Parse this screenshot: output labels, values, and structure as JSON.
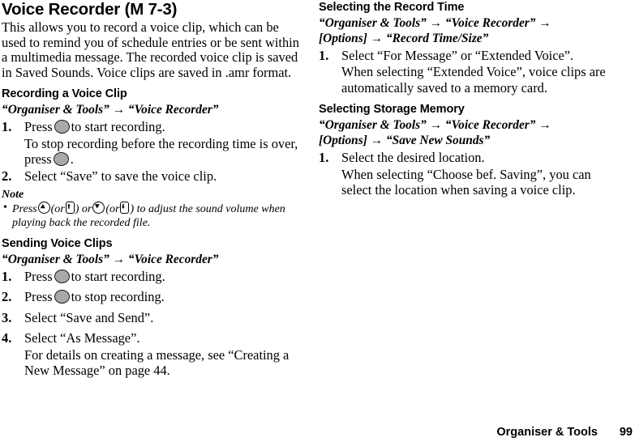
{
  "document": {
    "title": "Voice Recorder (M 7-3)",
    "intro": "This allows you to record a voice clip, which can be used to remind you of schedule entries or be sent within a multimedia message. The recorded voice clip is saved in Saved Sounds. Voice clips are saved in .amr format."
  },
  "arrow_glyph": "→",
  "bullet_glyph": "•",
  "left_column": {
    "sections": [
      {
        "heading": "Recording a Voice Clip",
        "path": "“Organiser & Tools” → “Voice Recorder”",
        "steps": [
          {
            "num": "1.",
            "text_before": "Press",
            "icon": "center-key-icon",
            "text_after": "to start recording.",
            "sub_before": "To stop recording before the recording time is over, press",
            "sub_icon": "center-key-icon",
            "sub_after": "."
          },
          {
            "num": "2.",
            "text": "Select “Save” to save the voice clip."
          }
        ],
        "note": {
          "label": "Note",
          "bullet_part_1": "Press",
          "icon_1": "nav-key-up-icon",
          "bullet_part_2": "(or",
          "icon_2": "side-key-up-icon",
          "bullet_part_3": ") or",
          "icon_3": "nav-key-down-icon",
          "bullet_part_4": "(or",
          "icon_4": "side-key-down-icon",
          "bullet_part_5": ") to adjust the sound volume when playing back the recorded file."
        }
      },
      {
        "heading": "Sending Voice Clips",
        "path": "“Organiser & Tools” → “Voice Recorder”",
        "steps": [
          {
            "num": "1.",
            "text_before": "Press",
            "icon": "center-key-icon",
            "text_after": "to start recording."
          },
          {
            "num": "2.",
            "text_before": "Press",
            "icon": "center-key-icon",
            "text_after": "to stop recording."
          },
          {
            "num": "3.",
            "text": "Select “Save and Send”."
          },
          {
            "num": "4.",
            "text": "Select “As Message”.",
            "sub": "For details on creating a message, see “Creating a New Message” on page 44."
          }
        ]
      }
    ]
  },
  "right_column": {
    "sections": [
      {
        "heading": "Selecting the Record Time",
        "path_line_1": "“Organiser & Tools” → “Voice Recorder” →",
        "path_line_2": "[Options] → “Record Time/Size”",
        "steps": [
          {
            "num": "1.",
            "text": "Select “For Message” or “Extended Voice”.",
            "sub": "When selecting “Extended Voice”, voice clips are automatically saved to a memory card."
          }
        ]
      },
      {
        "heading": "Selecting Storage Memory",
        "path_line_1": "“Organiser & Tools” → “Voice Recorder” →",
        "path_line_2": "[Options] → “Save New Sounds”",
        "steps": [
          {
            "num": "1.",
            "text": "Select the desired location.",
            "sub": "When selecting “Choose bef. Saving”, you can select the location when saving a voice clip."
          }
        ]
      }
    ]
  },
  "footer": {
    "chapter": "Organiser & Tools",
    "page_number": "99"
  }
}
